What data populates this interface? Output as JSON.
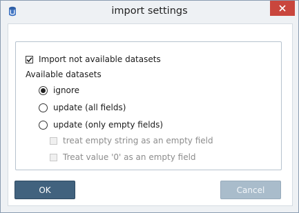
{
  "window": {
    "title": "import settings",
    "app_icon": "database-icon",
    "close_icon": "close-icon"
  },
  "options": {
    "import_not_available": {
      "label": "Import not available datasets",
      "checked": true
    },
    "section_label": "Available datasets",
    "radios": [
      {
        "label": "ignore",
        "selected": true
      },
      {
        "label": "update (all fields)",
        "selected": false
      },
      {
        "label": "update (only empty fields)",
        "selected": false
      }
    ],
    "sub_options": [
      {
        "label": "treat empty string as an empty field",
        "checked": false,
        "enabled": false
      },
      {
        "label": "Treat value '0' as an empty field",
        "checked": false,
        "enabled": false
      }
    ]
  },
  "buttons": {
    "ok_label": "OK",
    "cancel_label": "Cancel"
  },
  "colors": {
    "ok_button": "#41627e",
    "cancel_button_disabled": "#a9bccb",
    "close_button": "#c9463d"
  }
}
